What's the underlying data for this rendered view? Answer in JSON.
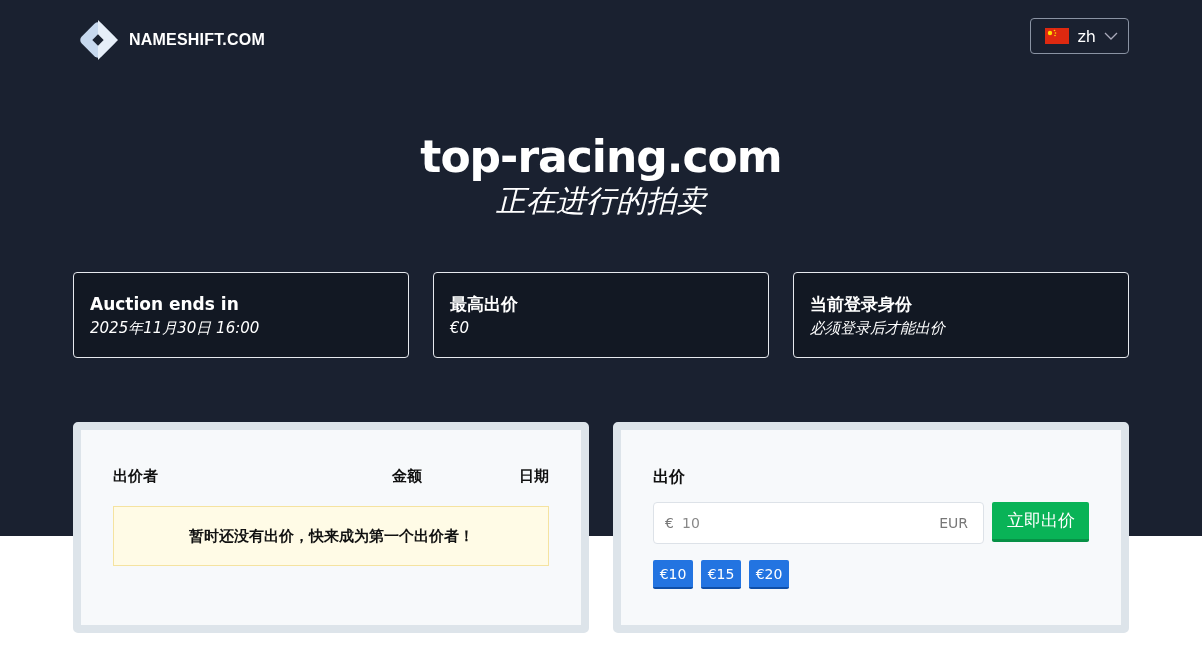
{
  "header": {
    "brand": "NAMESHIFT.COM",
    "language": {
      "code": "zh"
    }
  },
  "hero": {
    "domain": "top-racing.com",
    "status": "正在进行的拍卖"
  },
  "info_cards": [
    {
      "title": "Auction ends in",
      "value": "2025年11月30日 16:00"
    },
    {
      "title": "最高出价",
      "value": "€0"
    },
    {
      "title": "当前登录身份",
      "value": "必须登录后才能出价"
    }
  ],
  "bids_table": {
    "columns": [
      "出价者",
      "金额",
      "日期"
    ],
    "empty_message": "暂时还没有出价，快来成为第一个出价者！"
  },
  "bid_form": {
    "title": "出价",
    "currency_symbol": "€",
    "placeholder": "10",
    "currency": "EUR",
    "submit": "立即出价",
    "quick_amounts": [
      "€10",
      "€15",
      "€20"
    ]
  }
}
